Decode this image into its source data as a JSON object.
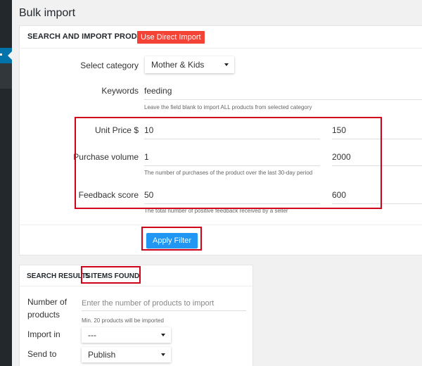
{
  "page": {
    "title": "Bulk import"
  },
  "search_panel": {
    "header": "SEARCH AND IMPORT PRODUCTS",
    "direct_import_label": "Use Direct Import",
    "category_label": "Select category",
    "category_value": "Mother & Kids",
    "keywords_label": "Keywords",
    "keywords_value": "feeding",
    "keywords_help": "Leave the field blank to import ALL products from selected category",
    "unit_price_label": "Unit Price $",
    "unit_price_min": "10",
    "unit_price_max": "150",
    "purchase_volume_label": "Purchase volume",
    "purchase_volume_min": "1",
    "purchase_volume_max": "2000",
    "purchase_volume_help": "The number of purchases of the product over the last 30-day period",
    "feedback_label": "Feedback score",
    "feedback_min": "50",
    "feedback_max": "600",
    "feedback_help": "The total number of positive feedback received by a seller",
    "apply_label": "Apply Filter"
  },
  "results_panel": {
    "title": "SEARCH RESULTS",
    "count": "5 ITEMS FOUND",
    "num_products_label": "Number of products",
    "num_products_placeholder": "Enter the number of products to import",
    "num_products_help": "Min. 20 products will be imported",
    "import_in_label": "Import in",
    "import_in_value": "---",
    "send_to_label": "Send to",
    "send_to_value": "Publish"
  },
  "colors": {
    "highlight": "#d0021b",
    "primary_button": "#2196f3",
    "danger_button": "#f44336",
    "admin_sidebar": "#23282d",
    "admin_active": "#0073aa"
  }
}
